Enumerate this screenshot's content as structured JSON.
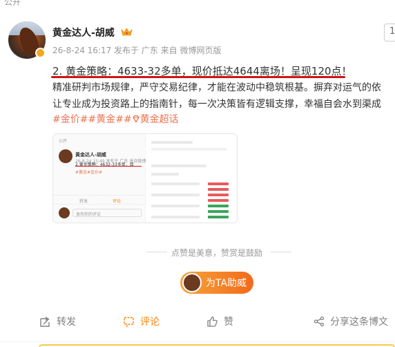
{
  "top_hint": "公开",
  "post": {
    "username": "黄金达人-胡威",
    "meta": "26-8-24 16:17  发布于 广东  来自 微博网页版",
    "follow_edge": "1",
    "line1": "2. 黄金策略：4633-32多单，现价抵达4644离场！呈现120点！",
    "line2": "精准研判市场规律，严守交易纪律，才能在波动中稳筑根基。摒弃对运气的依",
    "line3": "让专业成为投资路上的指南针，每一次决策皆有逻辑支撑，幸福自会水到渠成",
    "tags": {
      "t1": "#金价#",
      "t2": "#黄金#",
      "t3": "黄金超话"
    },
    "accent": "#eb7350",
    "underline_color": "#d01414"
  },
  "thumbnail": {
    "hint": "公开",
    "name": "黄金达人-胡威",
    "meta": "26-8-24 15:49 发布于 广东 来自微博",
    "text": "2.黄金策略：4632-33多单，目",
    "tags": "#黄金#金价#",
    "repost": "转发",
    "comment": "评论",
    "input": "发布你的评论"
  },
  "reward": {
    "divider_text": "点赞是美意，赞赏是鼓励",
    "button_label": "为TA助威",
    "gradient_start": "#f7a43a",
    "gradient_end": "#f26a1b"
  },
  "actions": {
    "repost": "转发",
    "comment": "评论",
    "like": "赞",
    "share": "分享这条博文",
    "active_color": "#ff8200"
  }
}
